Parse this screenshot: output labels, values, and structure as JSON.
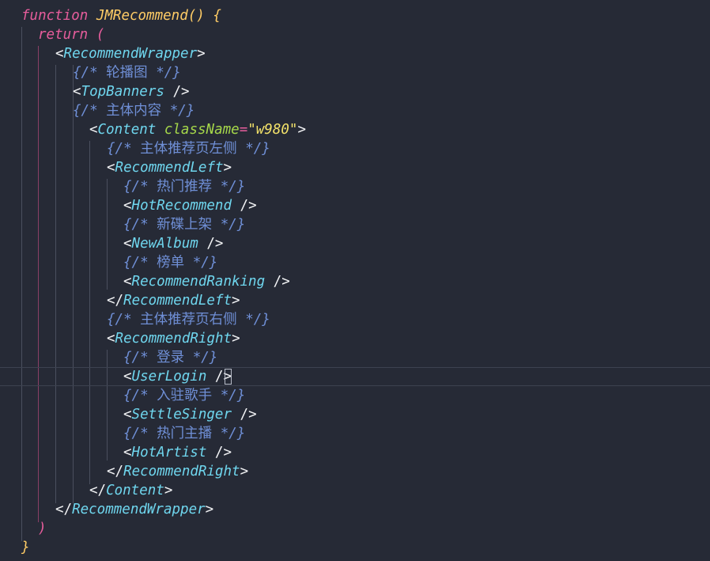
{
  "colors": {
    "background": "#262a36",
    "keyword": "#e75d9c",
    "function_name": "#ffcc66",
    "component_tag": "#6fd6ee",
    "comment": "#6f8fd6",
    "attribute": "#a6d84a",
    "string": "#f3e26a",
    "punctuation": "#f2f3f5"
  },
  "code": {
    "line1": {
      "kw": "function",
      "name": "JMRecommend",
      "parens": "()",
      "brace": "{"
    },
    "line2": {
      "kw": "return",
      "paren": "("
    },
    "line3": {
      "open": "<",
      "tag": "RecommendWrapper",
      "close": ">"
    },
    "line4": {
      "open": "{/*",
      "text": "轮播图",
      "close": "*/}"
    },
    "line5": {
      "open": "<",
      "tag": "TopBanners",
      "close": "/>"
    },
    "line6": {
      "open": "{/*",
      "text": "主体内容",
      "close": "*/}"
    },
    "line7": {
      "open": "<",
      "tag": "Content",
      "attr": "className",
      "eq": "=",
      "value": "\"w980\"",
      "close": ">"
    },
    "line8": {
      "open": "{/*",
      "text": "主体推荐页左侧",
      "close": "*/}"
    },
    "line9": {
      "open": "<",
      "tag": "RecommendLeft",
      "close": ">"
    },
    "line10": {
      "open": "{/*",
      "text": "热门推荐",
      "close": "*/}"
    },
    "line11": {
      "open": "<",
      "tag": "HotRecommend",
      "close": "/>"
    },
    "line12": {
      "open": "{/*",
      "text": "新碟上架",
      "close": "*/}"
    },
    "line13": {
      "open": "<",
      "tag": "NewAlbum",
      "close": "/>"
    },
    "line14": {
      "open": "{/*",
      "text": "榜单",
      "close": "*/}"
    },
    "line15": {
      "open": "<",
      "tag": "RecommendRanking",
      "close": "/>"
    },
    "line16": {
      "open": "</",
      "tag": "RecommendLeft",
      "close": ">"
    },
    "line17": {
      "open": "{/*",
      "text": "主体推荐页右侧",
      "close": "*/}"
    },
    "line18": {
      "open": "<",
      "tag": "RecommendRight",
      "close": ">"
    },
    "line19": {
      "open": "{/*",
      "text": "登录",
      "close": "*/}"
    },
    "line20": {
      "open": "<",
      "tag": "UserLogin",
      "close": "/>"
    },
    "line21": {
      "open": "{/*",
      "text": "入驻歌手",
      "close": "*/}"
    },
    "line22": {
      "open": "<",
      "tag": "SettleSinger",
      "close": "/>"
    },
    "line23": {
      "open": "{/*",
      "text": "热门主播",
      "close": "*/}"
    },
    "line24": {
      "open": "<",
      "tag": "HotArtist",
      "close": "/>"
    },
    "line25": {
      "open": "</",
      "tag": "RecommendRight",
      "close": ">"
    },
    "line26": {
      "open": "</",
      "tag": "Content",
      "close": ">"
    },
    "line27": {
      "open": "</",
      "tag": "RecommendWrapper",
      "close": ">"
    },
    "line28": {
      "paren": ")"
    },
    "line29": {
      "brace": "}"
    }
  }
}
